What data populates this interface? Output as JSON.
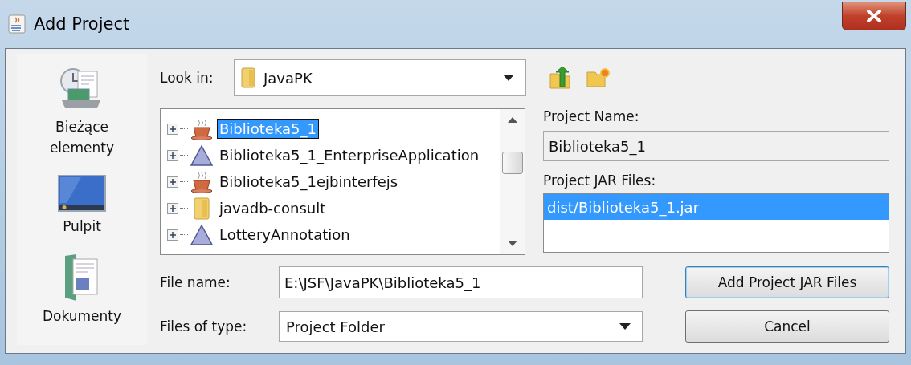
{
  "window": {
    "title": "Add Project"
  },
  "places": [
    {
      "label": "Bieżące elementy",
      "kind": "recent"
    },
    {
      "label": "Pulpit",
      "kind": "desktop"
    },
    {
      "label": "Dokumenty",
      "kind": "documents"
    }
  ],
  "look_in": {
    "label": "Look in:",
    "value": "JavaPK"
  },
  "tree": {
    "items": [
      {
        "text": "Biblioteka5_1",
        "kind": "cup",
        "selected": true,
        "expanded": false
      },
      {
        "text": "Biblioteka5_1_EnterpriseApplication",
        "kind": "triangle",
        "selected": false,
        "expanded": false
      },
      {
        "text": "Biblioteka5_1ejbinterfejs",
        "kind": "cup",
        "selected": false,
        "expanded": false
      },
      {
        "text": "javadb-consult",
        "kind": "folder",
        "selected": false,
        "expanded": false
      },
      {
        "text": "LotteryAnnotation",
        "kind": "triangle",
        "selected": false,
        "expanded": false
      }
    ]
  },
  "project_name": {
    "label": "Project Name:",
    "value": "Biblioteka5_1"
  },
  "jar_files": {
    "label": "Project JAR Files:",
    "items": [
      {
        "text": "dist/Biblioteka5_1.jar",
        "selected": true
      }
    ]
  },
  "file_name": {
    "label": "File name:",
    "value": "E:\\JSF\\JavaPK\\Biblioteka5_1"
  },
  "file_type": {
    "label": "Files of type:",
    "value": "Project Folder"
  },
  "buttons": [
    {
      "label": "Add Project JAR Files",
      "default": true
    },
    {
      "label": "Cancel",
      "default": false
    }
  ]
}
